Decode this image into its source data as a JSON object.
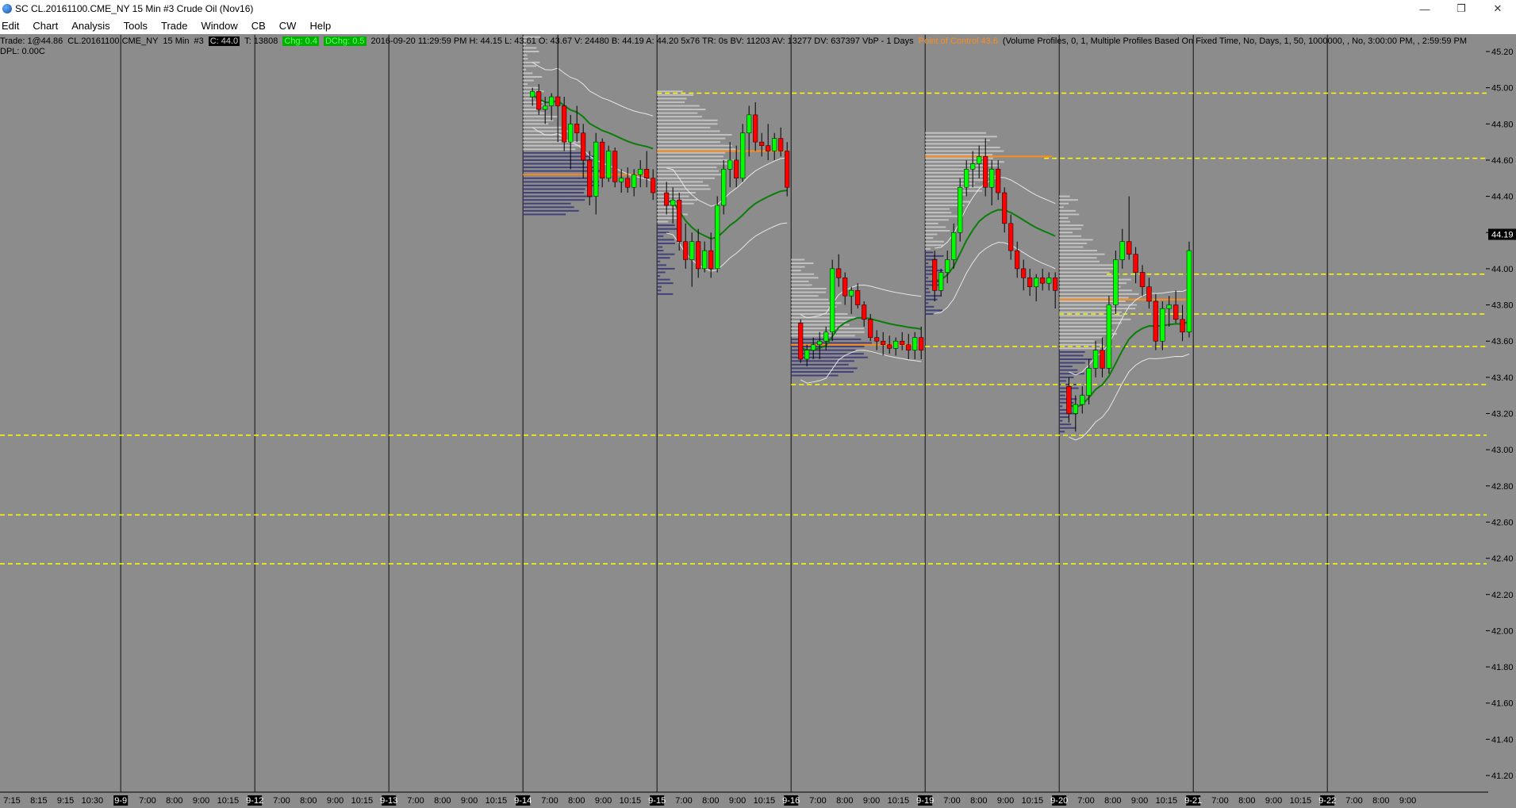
{
  "window": {
    "title": "SC CL.20161100.CME_NY  15 Min  #3  Crude Oil (Nov16)",
    "minimize": "—",
    "restore": "❐",
    "close": "✕"
  },
  "menu": [
    "Edit",
    "Chart",
    "Analysis",
    "Tools",
    "Trade",
    "Window",
    "CB",
    "CW",
    "Help"
  ],
  "infobar": {
    "trade": "Trade: 1@44.86",
    "symbol": "CL.20161100.CME_NY",
    "interval": "15 Min",
    "chart_no": "#3",
    "close_badge": "C: 44.0",
    "ticks": "T: 13808",
    "chg_badge": "Chg: 0.4",
    "dchg_badge": "DChg: 0.5",
    "stats": "2016-09-20 11:29:59 PM  H: 44.15  L: 43.61  O: 43.67  V: 24480  B: 44.19  A: 44.20  5x76  TR: 0s  BV: 11203  AV: 13277  DV: 637397  VbP - 1 Days",
    "poc": "Point of Control 43.6",
    "study": "(Volume Profiles, 0, 1, Multiple Profiles Based On Fixed Time, No, Days, 1, 50, 1000000, , No, 3:00:00 PM, , 2:59:59 PM"
  },
  "dpl": "DPL: 0.00C",
  "colors": {
    "background": "#8c8c8c",
    "up_candle": "#00ff00",
    "down_candle": "#ff0000",
    "vwap": "#0a7d0a",
    "bands": "#e6e6e6",
    "profile_light": "#c8c8c8",
    "profile_dark": "#3a3a78",
    "poc": "#ff8c1a",
    "levels": "#ffff00",
    "last_price_box": "#000000"
  },
  "chart_data": {
    "type": "candlestick",
    "title": "Crude Oil (Nov16)",
    "ylim": [
      41.1,
      45.3
    ],
    "y_ticks": [
      "45.20",
      "45.00",
      "44.80",
      "44.60",
      "44.40",
      "44.20",
      "44.00",
      "43.80",
      "43.60",
      "43.40",
      "43.20",
      "43.00",
      "42.80",
      "42.60",
      "42.40",
      "42.20",
      "42.00",
      "41.80",
      "41.60",
      "41.40",
      "41.20"
    ],
    "last_price": "44.19",
    "x_ticks": [
      {
        "label": "7:15",
        "d": false
      },
      {
        "label": "8:15",
        "d": false
      },
      {
        "label": "9:15",
        "d": false
      },
      {
        "label": "10:30",
        "d": false
      },
      {
        "label": "9-9",
        "d": true
      },
      {
        "label": "7:00",
        "d": false
      },
      {
        "label": "8:00",
        "d": false
      },
      {
        "label": "9:00",
        "d": false
      },
      {
        "label": "10:15",
        "d": false
      },
      {
        "label": "9-12",
        "d": true
      },
      {
        "label": "7:00",
        "d": false
      },
      {
        "label": "8:00",
        "d": false
      },
      {
        "label": "9:00",
        "d": false
      },
      {
        "label": "10:15",
        "d": false
      },
      {
        "label": "9-13",
        "d": true
      },
      {
        "label": "7:00",
        "d": false
      },
      {
        "label": "8:00",
        "d": false
      },
      {
        "label": "9:00",
        "d": false
      },
      {
        "label": "10:15",
        "d": false
      },
      {
        "label": "9-14",
        "d": true
      },
      {
        "label": "7:00",
        "d": false
      },
      {
        "label": "8:00",
        "d": false
      },
      {
        "label": "9:00",
        "d": false
      },
      {
        "label": "10:15",
        "d": false
      },
      {
        "label": "9-15",
        "d": true
      },
      {
        "label": "7:00",
        "d": false
      },
      {
        "label": "8:00",
        "d": false
      },
      {
        "label": "9:00",
        "d": false
      },
      {
        "label": "10:15",
        "d": false
      },
      {
        "label": "9-16",
        "d": true
      },
      {
        "label": "7:00",
        "d": false
      },
      {
        "label": "8:00",
        "d": false
      },
      {
        "label": "9:00",
        "d": false
      },
      {
        "label": "10:15",
        "d": false
      },
      {
        "label": "9-19",
        "d": true
      },
      {
        "label": "7:00",
        "d": false
      },
      {
        "label": "8:00",
        "d": false
      },
      {
        "label": "9:00",
        "d": false
      },
      {
        "label": "10:15",
        "d": false
      },
      {
        "label": "9-20",
        "d": true
      },
      {
        "label": "7:00",
        "d": false
      },
      {
        "label": "8:00",
        "d": false
      },
      {
        "label": "9:00",
        "d": false
      },
      {
        "label": "10:15",
        "d": false
      },
      {
        "label": "9-21",
        "d": true
      },
      {
        "label": "7:00",
        "d": false
      },
      {
        "label": "8:00",
        "d": false
      },
      {
        "label": "9:00",
        "d": false
      },
      {
        "label": "10:15",
        "d": false
      },
      {
        "label": "9-22",
        "d": true
      },
      {
        "label": "7:00",
        "d": false
      },
      {
        "label": "8:00",
        "d": false
      },
      {
        "label": "9:00",
        "d": false
      }
    ],
    "session_dividers": [
      "9-9",
      "9-12",
      "9-13",
      "9-14",
      "9-15",
      "9-16",
      "9-19",
      "9-20",
      "9-21",
      "9-22"
    ],
    "horizontal_levels": [
      {
        "price": 44.97,
        "from": "9-15"
      },
      {
        "price": 44.61,
        "from": "9-19 10:15"
      },
      {
        "price": 43.97,
        "from": "9-20 8:00"
      },
      {
        "price": 43.75,
        "from": "9-20"
      },
      {
        "price": 43.57,
        "from": "9-19"
      },
      {
        "price": 43.36,
        "from": "9-16"
      },
      {
        "price": 43.08,
        "from": "start"
      },
      {
        "price": 42.64,
        "from": "start"
      },
      {
        "price": 42.37,
        "from": "start"
      }
    ],
    "sessions": [
      {
        "date": "9-14",
        "open": 45.0,
        "high": 45.3,
        "low": 44.3,
        "close": 44.55,
        "poc": 44.52,
        "candles": [
          [
            44.95,
            45.0,
            44.9,
            44.98
          ],
          [
            44.98,
            45.02,
            44.85,
            44.88
          ],
          [
            44.88,
            44.95,
            44.8,
            44.9
          ],
          [
            44.9,
            44.97,
            44.82,
            44.95
          ],
          [
            44.95,
            45.3,
            44.7,
            44.9
          ],
          [
            44.9,
            44.95,
            44.65,
            44.7
          ],
          [
            44.7,
            44.85,
            44.55,
            44.8
          ],
          [
            44.8,
            44.9,
            44.7,
            44.75
          ],
          [
            44.75,
            44.8,
            44.5,
            44.6
          ],
          [
            44.6,
            44.65,
            44.35,
            44.4
          ],
          [
            44.4,
            44.75,
            44.3,
            44.7
          ],
          [
            44.7,
            44.72,
            44.45,
            44.5
          ],
          [
            44.5,
            44.68,
            44.48,
            44.65
          ],
          [
            44.65,
            44.67,
            44.45,
            44.48
          ],
          [
            44.48,
            44.55,
            44.42,
            44.5
          ],
          [
            44.5,
            44.56,
            44.42,
            44.45
          ],
          [
            44.45,
            44.55,
            44.4,
            44.52
          ],
          [
            44.52,
            44.6,
            44.45,
            44.55
          ],
          [
            44.55,
            44.65,
            44.45,
            44.5
          ],
          [
            44.5,
            44.55,
            44.38,
            44.42
          ]
        ]
      },
      {
        "date": "9-15",
        "open": 44.42,
        "high": 44.98,
        "low": 43.85,
        "close": 44.62,
        "poc": 44.65,
        "candles": [
          [
            44.42,
            44.48,
            44.3,
            44.35
          ],
          [
            44.35,
            44.45,
            44.25,
            44.38
          ],
          [
            44.38,
            44.42,
            44.1,
            44.15
          ],
          [
            44.15,
            44.25,
            44.0,
            44.05
          ],
          [
            44.05,
            44.2,
            43.9,
            44.15
          ],
          [
            44.15,
            44.22,
            43.95,
            44.0
          ],
          [
            44.0,
            44.15,
            43.98,
            44.1
          ],
          [
            44.1,
            44.2,
            43.95,
            44.0
          ],
          [
            44.0,
            44.4,
            43.98,
            44.35
          ],
          [
            44.35,
            44.6,
            44.3,
            44.55
          ],
          [
            44.55,
            44.7,
            44.45,
            44.6
          ],
          [
            44.6,
            44.68,
            44.45,
            44.5
          ],
          [
            44.5,
            44.8,
            44.48,
            44.75
          ],
          [
            44.75,
            44.9,
            44.62,
            44.85
          ],
          [
            44.85,
            44.92,
            44.65,
            44.7
          ],
          [
            44.7,
            44.75,
            44.62,
            44.68
          ],
          [
            44.68,
            44.8,
            44.6,
            44.65
          ],
          [
            44.65,
            44.75,
            44.6,
            44.72
          ],
          [
            44.72,
            44.78,
            44.62,
            44.65
          ],
          [
            44.65,
            44.7,
            44.4,
            44.45
          ]
        ]
      },
      {
        "date": "9-16",
        "open": 43.7,
        "high": 44.05,
        "low": 43.4,
        "close": 43.6,
        "poc": 43.58,
        "candles": [
          [
            43.7,
            43.72,
            43.48,
            43.5
          ],
          [
            43.5,
            43.58,
            43.46,
            43.55
          ],
          [
            43.55,
            43.62,
            43.5,
            43.58
          ],
          [
            43.58,
            43.65,
            43.5,
            43.6
          ],
          [
            43.6,
            43.68,
            43.55,
            43.65
          ],
          [
            43.65,
            44.05,
            43.6,
            44.0
          ],
          [
            44.0,
            44.08,
            43.9,
            43.95
          ],
          [
            43.95,
            43.98,
            43.8,
            43.85
          ],
          [
            43.85,
            43.9,
            43.75,
            43.88
          ],
          [
            43.88,
            43.92,
            43.78,
            43.8
          ],
          [
            43.8,
            43.82,
            43.68,
            43.72
          ],
          [
            43.72,
            43.75,
            43.6,
            43.62
          ],
          [
            43.62,
            43.66,
            43.55,
            43.6
          ],
          [
            43.6,
            43.65,
            43.52,
            43.58
          ],
          [
            43.58,
            43.63,
            43.53,
            43.56
          ],
          [
            43.56,
            43.62,
            43.52,
            43.6
          ],
          [
            43.6,
            43.65,
            43.55,
            43.58
          ],
          [
            43.58,
            43.64,
            43.5,
            43.55
          ],
          [
            43.55,
            43.65,
            43.5,
            43.62
          ],
          [
            43.62,
            43.68,
            43.5,
            43.55
          ]
        ]
      },
      {
        "date": "9-19",
        "open": 43.85,
        "high": 44.75,
        "low": 43.75,
        "close": 43.9,
        "poc": 44.62,
        "candles": [
          [
            44.05,
            44.1,
            43.82,
            43.88
          ],
          [
            43.88,
            44.0,
            43.85,
            43.98
          ],
          [
            43.98,
            44.1,
            43.92,
            44.05
          ],
          [
            44.05,
            44.25,
            44.0,
            44.2
          ],
          [
            44.2,
            44.5,
            44.15,
            44.45
          ],
          [
            44.45,
            44.6,
            44.4,
            44.55
          ],
          [
            44.55,
            44.65,
            44.45,
            44.58
          ],
          [
            44.58,
            44.68,
            44.5,
            44.62
          ],
          [
            44.62,
            44.72,
            44.4,
            44.45
          ],
          [
            44.45,
            44.6,
            44.35,
            44.55
          ],
          [
            44.55,
            44.6,
            44.38,
            44.42
          ],
          [
            44.42,
            44.45,
            44.2,
            44.25
          ],
          [
            44.25,
            44.3,
            44.05,
            44.1
          ],
          [
            44.1,
            44.15,
            43.95,
            44.0
          ],
          [
            44.0,
            44.05,
            43.88,
            43.95
          ],
          [
            43.95,
            44.0,
            43.85,
            43.9
          ],
          [
            43.9,
            43.97,
            43.82,
            43.95
          ],
          [
            43.95,
            44.0,
            43.88,
            43.92
          ],
          [
            43.92,
            43.98,
            43.88,
            43.95
          ],
          [
            43.95,
            43.98,
            43.78,
            43.88
          ]
        ]
      },
      {
        "date": "9-20",
        "open": 43.35,
        "high": 44.4,
        "low": 43.1,
        "close": 44.1,
        "poc": 43.83,
        "candles": [
          [
            43.35,
            43.4,
            43.15,
            43.2
          ],
          [
            43.2,
            43.3,
            43.1,
            43.25
          ],
          [
            43.25,
            43.35,
            43.2,
            43.3
          ],
          [
            43.3,
            43.5,
            43.25,
            43.45
          ],
          [
            43.45,
            43.6,
            43.4,
            43.55
          ],
          [
            43.55,
            43.62,
            43.4,
            43.45
          ],
          [
            43.45,
            43.85,
            43.42,
            43.8
          ],
          [
            43.8,
            44.1,
            43.75,
            44.05
          ],
          [
            44.05,
            44.22,
            44.0,
            44.15
          ],
          [
            44.15,
            44.4,
            44.05,
            44.08
          ],
          [
            44.08,
            44.12,
            43.92,
            43.98
          ],
          [
            43.98,
            44.02,
            43.85,
            43.9
          ],
          [
            43.9,
            43.95,
            43.78,
            43.82
          ],
          [
            43.82,
            43.86,
            43.55,
            43.6
          ],
          [
            43.6,
            43.82,
            43.55,
            43.78
          ],
          [
            43.78,
            43.85,
            43.68,
            43.8
          ],
          [
            43.8,
            43.88,
            43.7,
            43.72
          ],
          [
            43.72,
            43.8,
            43.6,
            43.65
          ],
          [
            43.65,
            44.15,
            43.62,
            44.1
          ]
        ]
      }
    ]
  }
}
